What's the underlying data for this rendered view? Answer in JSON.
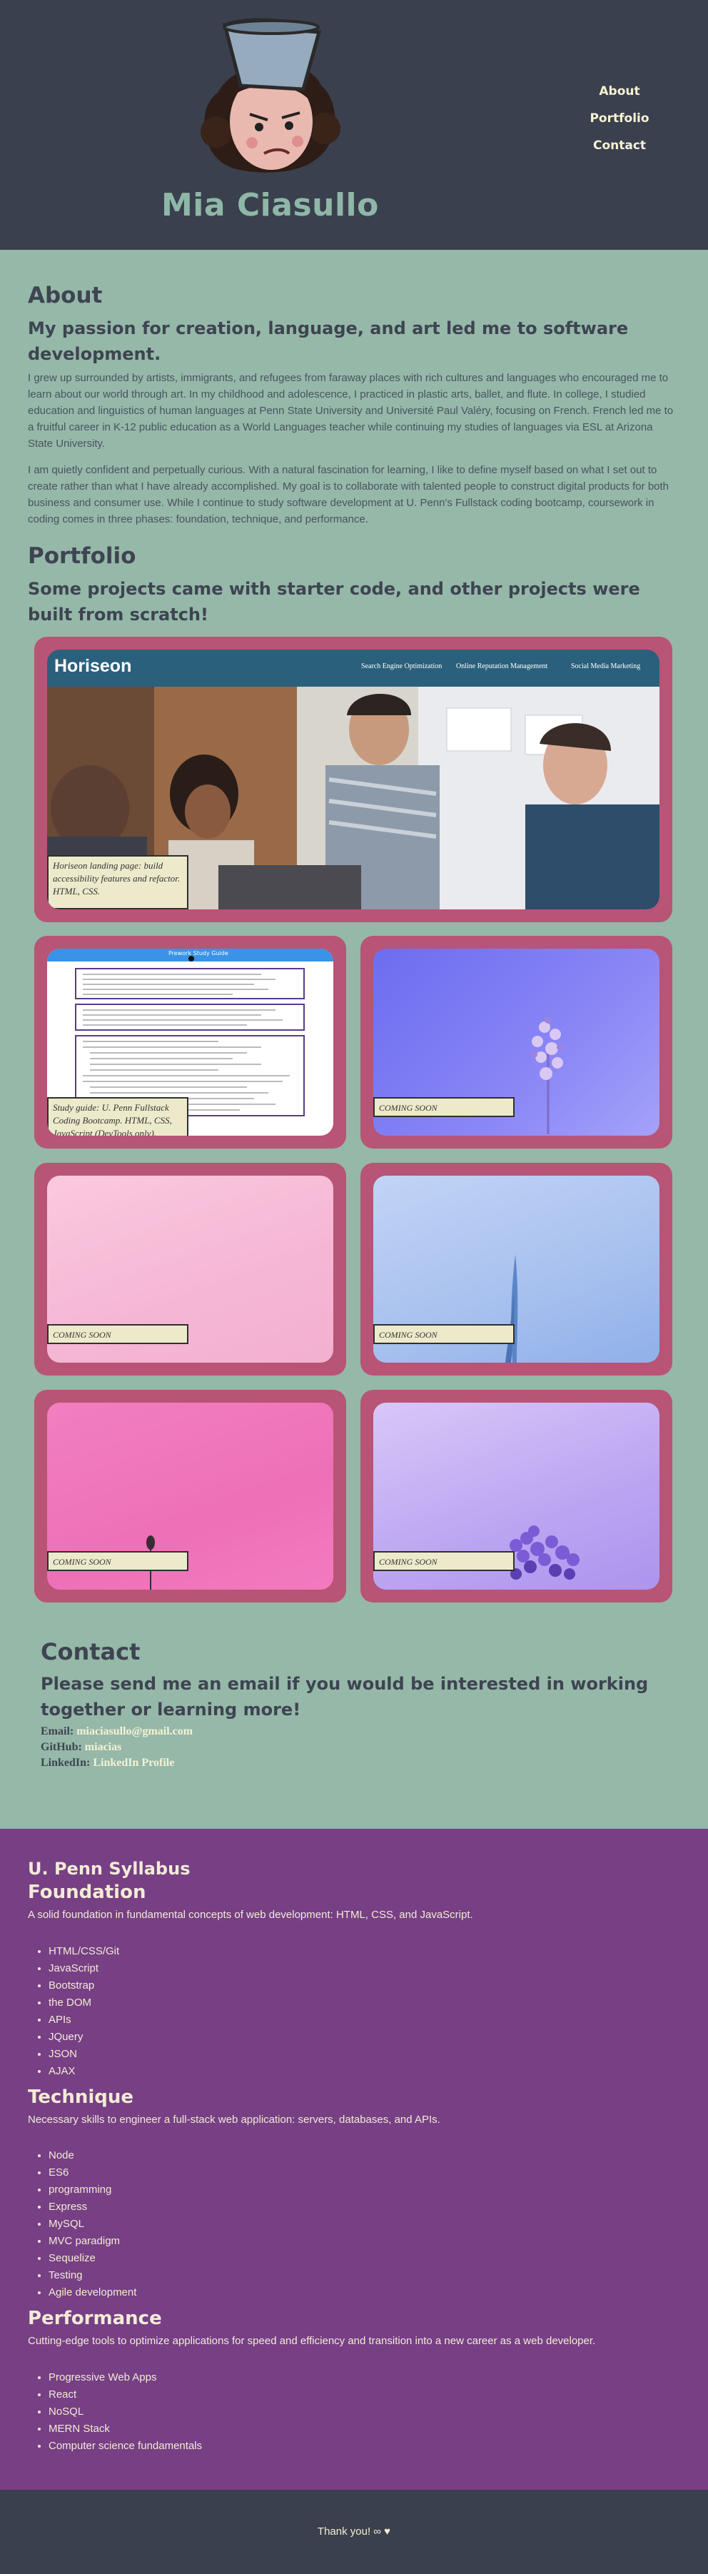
{
  "header": {
    "name": "Mia Ciasullo",
    "nav": [
      "About",
      "Portfolio",
      "Contact"
    ]
  },
  "about": {
    "heading": "About",
    "subheading": "My passion for creation, language, and art led me to software development.",
    "p1": "I grew up surrounded by artists, immigrants, and refugees from faraway places with rich cultures and languages who encouraged me to learn about our world through art. In my childhood and adolescence, I practiced in plastic arts, ballet, and flute. In college, I studied education and linguistics of human languages at Penn State University and Université Paul Valéry, focusing on French. French led me to a fruitful career in K-12 public education as a World Languages teacher while continuing my studies of languages via ESL at Arizona State University.",
    "p2": "I am quietly confident and perpetually curious. With a natural fascination for learning, I like to define myself based on what I set out to create rather than what I have already accomplished. My goal is to collaborate with talented people to construct digital products for both business and consumer use. While I continue to study software development at U. Penn's Fullstack coding bootcamp, coursework in coding comes in three phases: foundation, technique, and performance."
  },
  "portfolio": {
    "heading": "Portfolio",
    "subheading": "Some projects came with starter code, and other projects were built from scratch!",
    "horiseon": {
      "brand": "Horiseon",
      "nav": [
        "Search Engine Optimization",
        "Online Reputation Management",
        "Social Media Marketing"
      ],
      "caption": "Horiseon landing page: build accessibility features and refactor. HTML, CSS."
    },
    "study_guide": {
      "title": "Prework Study Guide",
      "caption": "Study guide: U. Penn Fullstack Coding Bootcamp. HTML, CSS, JavaScript (DevTools only)."
    },
    "coming_soon": [
      "COMING SOON",
      "COMING SOON",
      "COMING SOON",
      "COMING SOON",
      "COMING SOON"
    ]
  },
  "contact": {
    "heading": "Contact",
    "subheading": "Please send me an email if you would be interested in working together or learning more!",
    "email_label": "Email:",
    "email": "miaciasullo@gmail.com",
    "github_label": "GitHub:",
    "github": "miacias",
    "linkedin_label": "LinkedIn:",
    "linkedin": "LinkedIn Profile"
  },
  "syllabus": {
    "title": "U. Penn Syllabus",
    "foundation": {
      "heading": "Foundation",
      "desc": "A solid foundation in fundamental concepts of web development: HTML, CSS, and JavaScript.",
      "items": [
        "HTML/CSS/Git",
        "JavaScript",
        "Bootstrap",
        "the DOM",
        "APIs",
        "JQuery",
        "JSON",
        "AJAX"
      ]
    },
    "technique": {
      "heading": "Technique",
      "desc": "Necessary skills to engineer a full-stack web application: servers, databases, and APIs.",
      "items": [
        "Node",
        "ES6",
        "programming",
        "Express",
        "MySQL",
        "MVC paradigm",
        "Sequelize",
        "Testing",
        "Agile development"
      ]
    },
    "performance": {
      "heading": "Performance",
      "desc": "Cutting-edge tools to optimize applications for speed and efficiency and transition into a new career as a web developer.",
      "items": [
        "Progressive Web Apps",
        "React",
        "NoSQL",
        "MERN Stack",
        "Computer science fundamentals"
      ]
    }
  },
  "footer": {
    "text": "Thank you! ∞ ♥"
  },
  "colors": {
    "header_bg": "#3a404d",
    "page_bg": "#95b8a8",
    "card": "#b85475",
    "syllabus_bg": "#773f84",
    "accent_text": "#f6f2d4"
  }
}
